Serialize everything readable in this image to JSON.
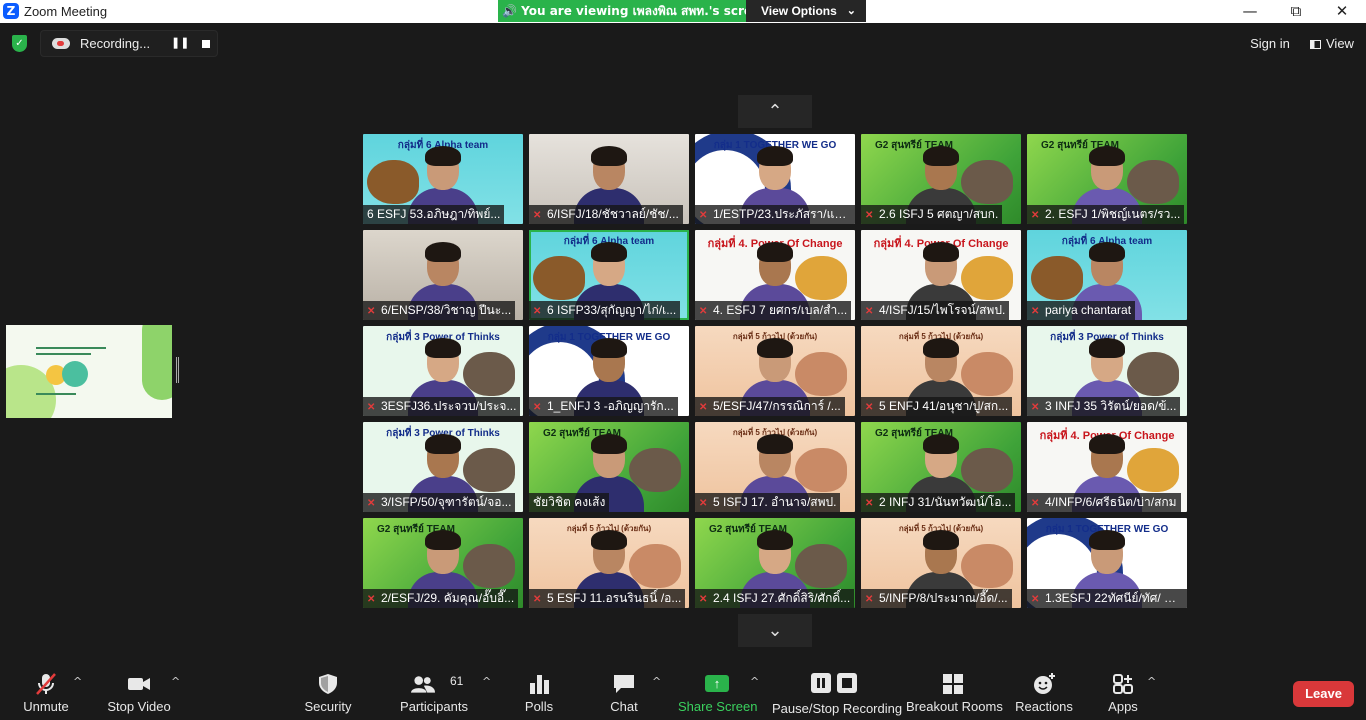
{
  "titlebar": {
    "app_icon": "Z",
    "title": "Zoom Meeting",
    "minimize": "—",
    "restore": "⧉",
    "close": "✕"
  },
  "share_banner": {
    "icon": "speaker-icon",
    "text": "You are viewing เพลงพิณ สพท.'s screen",
    "view_options": "View Options"
  },
  "recording": {
    "label": "Recording...",
    "pause_glyph": "❚❚"
  },
  "header_right": {
    "sign_in": "Sign in",
    "view": "View"
  },
  "navigation": {
    "up": "⌃",
    "down": "⌄"
  },
  "participants": [
    {
      "name": "6 ESFJ 53.อภิษฎา/ทิพย์...",
      "muted": false,
      "bg": "teal",
      "banner": "กลุ่มที่ 6  Alpha team"
    },
    {
      "name": "6/ISFJ/18/ชัชวาลย์/ชัช/...",
      "muted": true,
      "bg": "room",
      "banner": ""
    },
    {
      "name": "1/ESTP/23.ประภัสรา/แป๋...",
      "muted": true,
      "bg": "blueblob",
      "banner": "กลุ่ม 1  TOGETHER WE GO"
    },
    {
      "name": "2.6 ISFJ 5 ศตญา/สบก.",
      "muted": true,
      "bg": "green",
      "banner": "G2 สุนทรีย์ TEAM"
    },
    {
      "name": "2. ESFJ 1/พิชญ์เนตร/รว...",
      "muted": true,
      "bg": "green",
      "banner": "G2 สุนทรีย์ TEAM"
    },
    {
      "name": "6/ENSP/38/วิชาญ ปีนะ...",
      "muted": true,
      "bg": "office",
      "banner": ""
    },
    {
      "name": "6 ISFP33/สุกัญญา/ไก่/เ...",
      "muted": true,
      "bg": "teal",
      "banner": "กลุ่มที่ 6  Alpha team",
      "active": true
    },
    {
      "name": "4. ESFJ 7 ยศกร/เบล/สำ...",
      "muted": true,
      "bg": "white",
      "banner": "กลุ่มที่ 4. Power Of Change"
    },
    {
      "name": "4/ISFJ/15/ไพโรจน์/สพป.",
      "muted": true,
      "bg": "white",
      "banner": "กลุ่มที่ 4. Power Of Change"
    },
    {
      "name": "pariya chantarat",
      "muted": true,
      "bg": "teal",
      "banner": "กลุ่มที่ 6  Alpha team"
    },
    {
      "name": "3ESFJ36.ประจวบ/ประจ...",
      "muted": true,
      "bg": "mint",
      "banner": "กลุ่มที่ 3 Power of Thinks"
    },
    {
      "name": "1_ENFJ 3 -อภิญญารัก...",
      "muted": true,
      "bg": "blueblob",
      "banner": "กลุ่ม 1  TOGETHER WE GO"
    },
    {
      "name": "5/ESFJ/47/กรรณิการ์ /...",
      "muted": true,
      "bg": "peach",
      "banner": "กลุ่มที่ 5 ก้าวไป (ด้วยกัน)"
    },
    {
      "name": "5 ENFJ 41/อนุชา/ปู/สก...",
      "muted": true,
      "bg": "peach",
      "banner": "กลุ่มที่ 5 ก้าวไป (ด้วยกัน)"
    },
    {
      "name": "3 INFJ 35 วิรัตน์/ยอด/ข้...",
      "muted": true,
      "bg": "mint",
      "banner": "กลุ่มที่ 3 Power of Thinks"
    },
    {
      "name": "3/ISFP/50/จุฑารัตน์/จอ...",
      "muted": true,
      "bg": "mint",
      "banner": "กลุ่มที่ 3 Power of Thinks"
    },
    {
      "name": "ชัยวิชิต  คงเส้ง",
      "muted": false,
      "bg": "green",
      "banner": "G2 สุนทรีย์ TEAM"
    },
    {
      "name": "5 ISFJ 17. อำนาจ/สพป.",
      "muted": true,
      "bg": "peach",
      "banner": "กลุ่มที่ 5 ก้าวไป (ด้วยกัน)"
    },
    {
      "name": "2 INFJ 31/นันทวัฒน์/โอ...",
      "muted": true,
      "bg": "green",
      "banner": "G2 สุนทรีย์ TEAM"
    },
    {
      "name": "4/INFP/6/ศรีธนิต/บ่า/สกม",
      "muted": true,
      "bg": "white",
      "banner": "กลุ่มที่ 4. Power Of Change"
    },
    {
      "name": "2/ESFJ/29. คัมคุณ/อั๊บอี๊...",
      "muted": true,
      "bg": "green",
      "banner": "G2 สุนทรีย์ TEAM"
    },
    {
      "name": "5 ESFJ 11.อรนรินธนิ์ /อ...",
      "muted": true,
      "bg": "peach",
      "banner": "กลุ่มที่ 5 ก้าวไป (ด้วยกัน)"
    },
    {
      "name": "2.4 ISFJ 27.ศักดิ์สิริ/ศักดิ์...",
      "muted": true,
      "bg": "green",
      "banner": "G2 สุนทรีย์ TEAM"
    },
    {
      "name": "5/INFP/8/ประมาณ/อี๊ด/...",
      "muted": true,
      "bg": "peach",
      "banner": "กลุ่มที่ 5 ก้าวไป (ด้วยกัน)"
    },
    {
      "name": "1.3ESFJ 22ทัศนีย์/ทัศ/ สา...",
      "muted": true,
      "bg": "blueblob",
      "banner": "กลุ่ม 1  TOGETHER WE GO"
    }
  ],
  "toolbar": {
    "unmute": "Unmute",
    "stop_video": "Stop Video",
    "security": "Security",
    "participants": "Participants",
    "participants_count": "61",
    "polls": "Polls",
    "chat": "Chat",
    "share_screen": "Share Screen",
    "pause_stop_recording": "Pause/Stop Recording",
    "breakout_rooms": "Breakout Rooms",
    "reactions": "Reactions",
    "apps": "Apps",
    "leave": "Leave",
    "caret": "^"
  },
  "colors": {
    "accent_green": "#2ab34b",
    "leave_red": "#d9383a",
    "toolbar_bg": "#1a1a1a",
    "muted_red": "#e23b3b"
  }
}
